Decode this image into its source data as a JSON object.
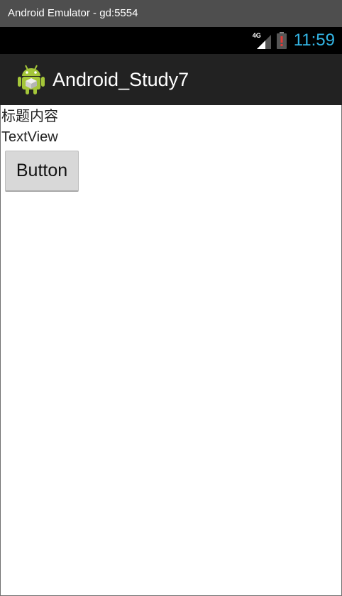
{
  "emulator": {
    "title": "Android Emulator - gd:5554"
  },
  "status_bar": {
    "network": "4G",
    "clock": "11:59",
    "icons": [
      "signal-icon",
      "battery-alert-icon"
    ],
    "clock_color": "#33b5e5"
  },
  "action_bar": {
    "app_icon": "android-robot-icon",
    "title": "Android_Study7",
    "background": "#222222"
  },
  "content": {
    "title_text": "标题内容",
    "text_view": "TextView",
    "button_label": "Button"
  }
}
